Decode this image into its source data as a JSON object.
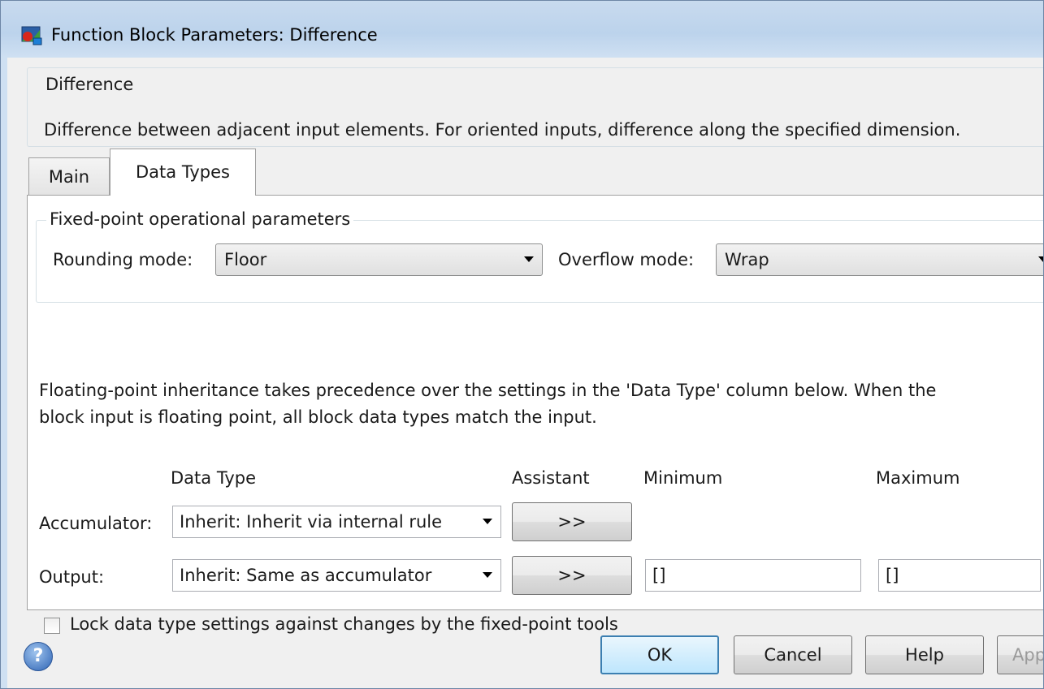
{
  "window": {
    "title": "Function Block Parameters: Difference"
  },
  "description": {
    "legend": "Difference",
    "text": "Difference between adjacent input elements.  For oriented inputs, difference along the specified dimension."
  },
  "tabs": [
    {
      "label": "Main",
      "active": false
    },
    {
      "label": "Data Types",
      "active": true
    }
  ],
  "fixed_point": {
    "legend": "Fixed-point operational parameters",
    "rounding_label": "Rounding mode:",
    "rounding_value": "Floor",
    "overflow_label": "Overflow mode:",
    "overflow_value": "Wrap"
  },
  "info_text": {
    "line1": "Floating-point inheritance takes precedence over the settings in the 'Data Type' column below. When the",
    "line2": "block input is floating point, all block data types match the input."
  },
  "table": {
    "headers": {
      "data_type": "Data Type",
      "assistant": "Assistant",
      "minimum": "Minimum",
      "maximum": "Maximum"
    },
    "rows": [
      {
        "label": "Accumulator:",
        "data_type": "Inherit: Inherit via internal rule",
        "assistant": ">>"
      },
      {
        "label": "Output:",
        "data_type": "Inherit: Same as accumulator",
        "assistant": ">>",
        "minimum": "[]",
        "maximum": "[]"
      }
    ]
  },
  "lock_checkbox": {
    "label": "Lock data type settings against changes by the fixed-point tools",
    "checked": false
  },
  "buttons": {
    "ok": "OK",
    "cancel": "Cancel",
    "help": "Help",
    "apply": "Apply"
  },
  "icons": {
    "title": "simulink-block-icon",
    "help": "help-question-icon"
  }
}
